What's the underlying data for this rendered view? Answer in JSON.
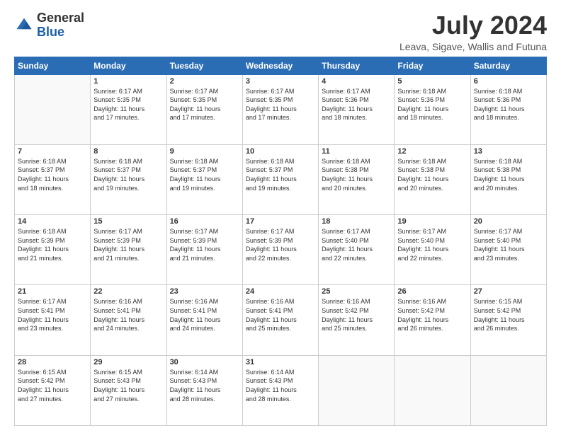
{
  "logo": {
    "general": "General",
    "blue": "Blue"
  },
  "title": "July 2024",
  "location": "Leava, Sigave, Wallis and Futuna",
  "weekdays": [
    "Sunday",
    "Monday",
    "Tuesday",
    "Wednesday",
    "Thursday",
    "Friday",
    "Saturday"
  ],
  "weeks": [
    [
      {
        "day": "",
        "info": ""
      },
      {
        "day": "1",
        "info": "Sunrise: 6:17 AM\nSunset: 5:35 PM\nDaylight: 11 hours\nand 17 minutes."
      },
      {
        "day": "2",
        "info": "Sunrise: 6:17 AM\nSunset: 5:35 PM\nDaylight: 11 hours\nand 17 minutes."
      },
      {
        "day": "3",
        "info": "Sunrise: 6:17 AM\nSunset: 5:35 PM\nDaylight: 11 hours\nand 17 minutes."
      },
      {
        "day": "4",
        "info": "Sunrise: 6:17 AM\nSunset: 5:36 PM\nDaylight: 11 hours\nand 18 minutes."
      },
      {
        "day": "5",
        "info": "Sunrise: 6:18 AM\nSunset: 5:36 PM\nDaylight: 11 hours\nand 18 minutes."
      },
      {
        "day": "6",
        "info": "Sunrise: 6:18 AM\nSunset: 5:36 PM\nDaylight: 11 hours\nand 18 minutes."
      }
    ],
    [
      {
        "day": "7",
        "info": "Sunrise: 6:18 AM\nSunset: 5:37 PM\nDaylight: 11 hours\nand 18 minutes."
      },
      {
        "day": "8",
        "info": "Sunrise: 6:18 AM\nSunset: 5:37 PM\nDaylight: 11 hours\nand 19 minutes."
      },
      {
        "day": "9",
        "info": "Sunrise: 6:18 AM\nSunset: 5:37 PM\nDaylight: 11 hours\nand 19 minutes."
      },
      {
        "day": "10",
        "info": "Sunrise: 6:18 AM\nSunset: 5:37 PM\nDaylight: 11 hours\nand 19 minutes."
      },
      {
        "day": "11",
        "info": "Sunrise: 6:18 AM\nSunset: 5:38 PM\nDaylight: 11 hours\nand 20 minutes."
      },
      {
        "day": "12",
        "info": "Sunrise: 6:18 AM\nSunset: 5:38 PM\nDaylight: 11 hours\nand 20 minutes."
      },
      {
        "day": "13",
        "info": "Sunrise: 6:18 AM\nSunset: 5:38 PM\nDaylight: 11 hours\nand 20 minutes."
      }
    ],
    [
      {
        "day": "14",
        "info": "Sunrise: 6:18 AM\nSunset: 5:39 PM\nDaylight: 11 hours\nand 21 minutes."
      },
      {
        "day": "15",
        "info": "Sunrise: 6:17 AM\nSunset: 5:39 PM\nDaylight: 11 hours\nand 21 minutes."
      },
      {
        "day": "16",
        "info": "Sunrise: 6:17 AM\nSunset: 5:39 PM\nDaylight: 11 hours\nand 21 minutes."
      },
      {
        "day": "17",
        "info": "Sunrise: 6:17 AM\nSunset: 5:39 PM\nDaylight: 11 hours\nand 22 minutes."
      },
      {
        "day": "18",
        "info": "Sunrise: 6:17 AM\nSunset: 5:40 PM\nDaylight: 11 hours\nand 22 minutes."
      },
      {
        "day": "19",
        "info": "Sunrise: 6:17 AM\nSunset: 5:40 PM\nDaylight: 11 hours\nand 22 minutes."
      },
      {
        "day": "20",
        "info": "Sunrise: 6:17 AM\nSunset: 5:40 PM\nDaylight: 11 hours\nand 23 minutes."
      }
    ],
    [
      {
        "day": "21",
        "info": "Sunrise: 6:17 AM\nSunset: 5:41 PM\nDaylight: 11 hours\nand 23 minutes."
      },
      {
        "day": "22",
        "info": "Sunrise: 6:16 AM\nSunset: 5:41 PM\nDaylight: 11 hours\nand 24 minutes."
      },
      {
        "day": "23",
        "info": "Sunrise: 6:16 AM\nSunset: 5:41 PM\nDaylight: 11 hours\nand 24 minutes."
      },
      {
        "day": "24",
        "info": "Sunrise: 6:16 AM\nSunset: 5:41 PM\nDaylight: 11 hours\nand 25 minutes."
      },
      {
        "day": "25",
        "info": "Sunrise: 6:16 AM\nSunset: 5:42 PM\nDaylight: 11 hours\nand 25 minutes."
      },
      {
        "day": "26",
        "info": "Sunrise: 6:16 AM\nSunset: 5:42 PM\nDaylight: 11 hours\nand 26 minutes."
      },
      {
        "day": "27",
        "info": "Sunrise: 6:15 AM\nSunset: 5:42 PM\nDaylight: 11 hours\nand 26 minutes."
      }
    ],
    [
      {
        "day": "28",
        "info": "Sunrise: 6:15 AM\nSunset: 5:42 PM\nDaylight: 11 hours\nand 27 minutes."
      },
      {
        "day": "29",
        "info": "Sunrise: 6:15 AM\nSunset: 5:43 PM\nDaylight: 11 hours\nand 27 minutes."
      },
      {
        "day": "30",
        "info": "Sunrise: 6:14 AM\nSunset: 5:43 PM\nDaylight: 11 hours\nand 28 minutes."
      },
      {
        "day": "31",
        "info": "Sunrise: 6:14 AM\nSunset: 5:43 PM\nDaylight: 11 hours\nand 28 minutes."
      },
      {
        "day": "",
        "info": ""
      },
      {
        "day": "",
        "info": ""
      },
      {
        "day": "",
        "info": ""
      }
    ]
  ]
}
